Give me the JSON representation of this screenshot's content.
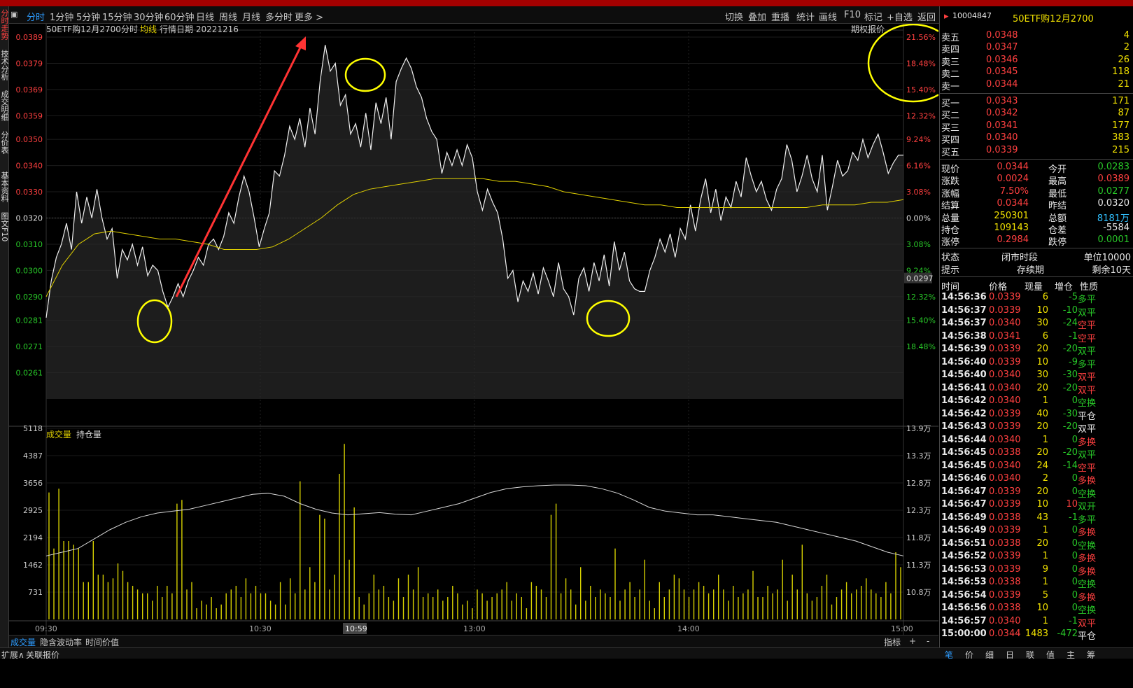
{
  "window": {
    "accent_color": "#a30000"
  },
  "left_rail": [
    "分时走势",
    "技术分析",
    "成交明细",
    "分价表",
    "基本资料",
    "图文F10"
  ],
  "tabs": [
    "分时",
    "1分钟",
    "5分钟",
    "15分钟",
    "30分钟",
    "60分钟",
    "日线",
    "周线",
    "月线",
    "多分时",
    "更多 >"
  ],
  "tools": [
    "切换",
    "叠加",
    "重播",
    "统计",
    "画线",
    "F10",
    "标记",
    "+自选",
    "返回"
  ],
  "chart_header": {
    "name": "50ETF购12月2700",
    "mode": "分时",
    "avg_label": "均线",
    "date_label": "行情日期 20221216",
    "right_label": "期权报价"
  },
  "chart_data": {
    "type": "line",
    "price_axis": {
      "ticks": [
        "0.0389",
        "0.0379",
        "0.0369",
        "0.0359",
        "0.0350",
        "0.0340",
        "0.0330",
        "0.0320",
        "0.0310",
        "0.0300",
        "0.0290",
        "0.0281",
        "0.0271",
        "0.0261"
      ],
      "pct_ticks": [
        "21.56%",
        "18.48%",
        "15.40%",
        "12.32%",
        "9.24%",
        "6.16%",
        "3.08%",
        "0.00%",
        "3.08%",
        "9.24%",
        "12.32%",
        "15.40%",
        "18.48%"
      ],
      "ylim": [
        0.0251,
        0.0389
      ],
      "prev_close": 0.032,
      "last_price_tag": "0.0297"
    },
    "price_series": [
      0.0282,
      0.0296,
      0.0305,
      0.031,
      0.0318,
      0.0308,
      0.033,
      0.0318,
      0.0328,
      0.032,
      0.0331,
      0.032,
      0.0312,
      0.0316,
      0.0297,
      0.0308,
      0.0304,
      0.031,
      0.0302,
      0.0309,
      0.0298,
      0.0302,
      0.03,
      0.0292,
      0.0286,
      0.029,
      0.0295,
      0.029,
      0.0296,
      0.03,
      0.0305,
      0.0302,
      0.031,
      0.0312,
      0.0308,
      0.0313,
      0.0322,
      0.0318,
      0.0328,
      0.0336,
      0.033,
      0.032,
      0.0309,
      0.0316,
      0.0322,
      0.0338,
      0.0336,
      0.0344,
      0.0355,
      0.035,
      0.0358,
      0.0347,
      0.0362,
      0.0352,
      0.0372,
      0.0386,
      0.0376,
      0.0379,
      0.0363,
      0.0367,
      0.0352,
      0.0356,
      0.0347,
      0.036,
      0.0346,
      0.0364,
      0.0356,
      0.0366,
      0.035,
      0.0372,
      0.0377,
      0.0381,
      0.0377,
      0.037,
      0.0366,
      0.0358,
      0.0353,
      0.035,
      0.0337,
      0.0345,
      0.034,
      0.0346,
      0.034,
      0.0348,
      0.0343,
      0.033,
      0.0323,
      0.0331,
      0.0326,
      0.0322,
      0.0312,
      0.0297,
      0.03,
      0.0288,
      0.0296,
      0.0292,
      0.0299,
      0.0291,
      0.0301,
      0.0296,
      0.029,
      0.0303,
      0.0293,
      0.029,
      0.0283,
      0.0297,
      0.0301,
      0.0292,
      0.0303,
      0.0296,
      0.0306,
      0.0294,
      0.0311,
      0.03,
      0.0307,
      0.0296,
      0.0293,
      0.0292,
      0.0292,
      0.03,
      0.0305,
      0.0312,
      0.0307,
      0.0314,
      0.0305,
      0.0316,
      0.0312,
      0.0325,
      0.0315,
      0.0327,
      0.0335,
      0.0322,
      0.0331,
      0.0319,
      0.0328,
      0.0324,
      0.0334,
      0.0328,
      0.0343,
      0.0336,
      0.033,
      0.0334,
      0.0327,
      0.0323,
      0.0331,
      0.0335,
      0.0348,
      0.0342,
      0.033,
      0.0336,
      0.0344,
      0.0335,
      0.033,
      0.0344,
      0.0323,
      0.0332,
      0.0342,
      0.0336,
      0.0338,
      0.0345,
      0.0342,
      0.035,
      0.0343,
      0.0348,
      0.0352,
      0.0345,
      0.0337,
      0.0341,
      0.0344,
      0.0344
    ],
    "avg_series": [
      0.029,
      0.0302,
      0.031,
      0.0314,
      0.0315,
      0.0314,
      0.0313,
      0.0312,
      0.0312,
      0.0311,
      0.031,
      0.0308,
      0.0308,
      0.0308,
      0.0309,
      0.0312,
      0.0316,
      0.032,
      0.0325,
      0.0329,
      0.0331,
      0.0332,
      0.0333,
      0.0334,
      0.0335,
      0.0335,
      0.0335,
      0.0335,
      0.0334,
      0.0334,
      0.0333,
      0.0332,
      0.033,
      0.0329,
      0.0328,
      0.0327,
      0.0326,
      0.0325,
      0.0325,
      0.0324,
      0.0324,
      0.0324,
      0.0324,
      0.0324,
      0.0324,
      0.0324,
      0.0324,
      0.0324,
      0.0325,
      0.0325,
      0.0325,
      0.0326,
      0.0326,
      0.0327
    ],
    "volume_axis": {
      "ticks": [
        "5118",
        "4387",
        "3656",
        "2925",
        "2194",
        "1462",
        "731"
      ],
      "oi_ticks": [
        "13.9万",
        "13.3万",
        "12.8万",
        "12.3万",
        "11.8万",
        "11.3万",
        "10.8万"
      ],
      "ylim": [
        0,
        5118
      ]
    },
    "volume_series": [
      3400,
      1900,
      3500,
      2100,
      2100,
      2000,
      1900,
      1000,
      1000,
      2100,
      1200,
      1200,
      1000,
      1100,
      1500,
      1300,
      1000,
      900,
      800,
      700,
      700,
      500,
      900,
      600,
      900,
      700,
      3100,
      3200,
      800,
      1000,
      300,
      500,
      400,
      600,
      300,
      400,
      700,
      800,
      900,
      600,
      1100,
      700,
      900,
      700,
      700,
      500,
      400,
      1000,
      400,
      1100,
      700,
      3700,
      800,
      1400,
      1000,
      2800,
      2700,
      800,
      1200,
      3900,
      4700,
      1600,
      3000,
      600,
      400,
      700,
      1200,
      800,
      900,
      600,
      500,
      1100,
      600,
      1200,
      800,
      1400,
      600,
      700,
      600,
      800,
      500,
      600,
      900,
      700,
      400,
      500,
      300,
      800,
      700,
      500,
      600,
      700,
      800,
      1000,
      500,
      700,
      600,
      300,
      1000,
      900,
      800,
      600,
      2800,
      3100,
      700,
      1100,
      800,
      400,
      1400,
      500,
      900,
      600,
      800,
      700,
      600,
      1900,
      500,
      800,
      1000,
      600,
      800,
      1600,
      500,
      300,
      1000,
      600,
      800,
      1200,
      1100,
      800,
      600,
      800,
      1000,
      900,
      700,
      800,
      1200,
      800,
      500,
      900,
      600,
      700,
      800,
      1300,
      600,
      600,
      900,
      700,
      800,
      1600,
      500,
      1200,
      800,
      2000,
      700,
      500,
      600,
      900,
      1200,
      400,
      600,
      800,
      1000,
      700,
      800,
      900,
      1100,
      800,
      700,
      600,
      1000,
      700,
      1800,
      1400
    ],
    "oi_series": [
      1700,
      1800,
      1900,
      2150,
      2400,
      2600,
      2750,
      2850,
      2900,
      2950,
      3050,
      3150,
      3250,
      3350,
      3380,
      3300,
      3100,
      2950,
      2850,
      2800,
      2830,
      2860,
      2820,
      2800,
      2900,
      3000,
      3100,
      3250,
      3400,
      3500,
      3550,
      3580,
      3600,
      3600,
      3580,
      3500,
      3380,
      3200,
      3000,
      2900,
      2850,
      2800,
      2800,
      2750,
      2700,
      2650,
      2600,
      2500,
      2400,
      2300,
      2200,
      2100,
      1950,
      1800,
      1700
    ],
    "xticks": [
      "09:30",
      "10:30",
      "13:00",
      "14:00",
      "15:00"
    ],
    "cursor_time": "10:59",
    "volume_legend": [
      "成交量",
      "持仓量"
    ]
  },
  "order_book": {
    "sell": [
      {
        "label": "卖五",
        "price": "0.0348",
        "qty": "4"
      },
      {
        "label": "卖四",
        "price": "0.0347",
        "qty": "2"
      },
      {
        "label": "卖三",
        "price": "0.0346",
        "qty": "26"
      },
      {
        "label": "卖二",
        "price": "0.0345",
        "qty": "118"
      },
      {
        "label": "卖一",
        "price": "0.0344",
        "qty": "21"
      }
    ],
    "buy": [
      {
        "label": "买一",
        "price": "0.0343",
        "qty": "171"
      },
      {
        "label": "买二",
        "price": "0.0342",
        "qty": "87"
      },
      {
        "label": "买三",
        "price": "0.0341",
        "qty": "177"
      },
      {
        "label": "买四",
        "price": "0.0340",
        "qty": "383"
      },
      {
        "label": "买五",
        "price": "0.0339",
        "qty": "215"
      }
    ]
  },
  "instrument": {
    "code": "10004847",
    "name": "50ETF购12月2700"
  },
  "quote": [
    {
      "l1": "现价",
      "v1": "0.0344",
      "c1": "red",
      "l2": "今开",
      "v2": "0.0283",
      "c2": "grn"
    },
    {
      "l1": "涨跌",
      "v1": "0.0024",
      "c1": "red",
      "l2": "最高",
      "v2": "0.0389",
      "c2": "red"
    },
    {
      "l1": "涨幅",
      "v1": "7.50%",
      "c1": "red",
      "l2": "最低",
      "v2": "0.0277",
      "c2": "grn"
    },
    {
      "l1": "结算",
      "v1": "0.0344",
      "c1": "red",
      "l2": "昨结",
      "v2": "0.0320",
      "c2": "wht"
    },
    {
      "l1": "总量",
      "v1": "250301",
      "c1": "yel",
      "l2": "总额",
      "v2": "8181万",
      "c2": "cyn"
    },
    {
      "l1": "持仓",
      "v1": "109143",
      "c1": "yel",
      "l2": "仓差",
      "v2": "-5584",
      "c2": "wht"
    },
    {
      "l1": "涨停",
      "v1": "0.2984",
      "c1": "red",
      "l2": "跌停",
      "v2": "0.0001",
      "c2": "grn"
    }
  ],
  "status": {
    "l1": "状态",
    "v1": "闭市时段",
    "u1": "单位10000",
    "l2": "提示",
    "v2": "存续期",
    "u2": "剩余10天"
  },
  "ticks_header": [
    "时间",
    "价格",
    "现量",
    "增仓",
    "性质"
  ],
  "ticks": [
    [
      "14:56:36",
      "0.0339",
      "6",
      "-5",
      "多平",
      "red",
      "grn"
    ],
    [
      "14:56:37",
      "0.0339",
      "10",
      "-10",
      "双平",
      "red",
      "grn"
    ],
    [
      "14:56:37",
      "0.0340",
      "30",
      "-24",
      "空平",
      "red",
      "red"
    ],
    [
      "14:56:38",
      "0.0341",
      "6",
      "-1",
      "空平",
      "red",
      "red"
    ],
    [
      "14:56:39",
      "0.0339",
      "20",
      "-20",
      "双平",
      "red",
      "grn"
    ],
    [
      "14:56:40",
      "0.0339",
      "10",
      "-9",
      "多平",
      "red",
      "grn"
    ],
    [
      "14:56:40",
      "0.0340",
      "30",
      "-30",
      "双平",
      "red",
      "red"
    ],
    [
      "14:56:41",
      "0.0340",
      "20",
      "-20",
      "双平",
      "red",
      "red"
    ],
    [
      "14:56:42",
      "0.0340",
      "1",
      "0",
      "空换",
      "red",
      "grn"
    ],
    [
      "14:56:42",
      "0.0339",
      "40",
      "-30",
      "平仓",
      "red",
      "wht"
    ],
    [
      "14:56:43",
      "0.0339",
      "20",
      "-20",
      "双平",
      "red",
      "wht"
    ],
    [
      "14:56:44",
      "0.0340",
      "1",
      "0",
      "多换",
      "red",
      "red"
    ],
    [
      "14:56:45",
      "0.0338",
      "20",
      "-20",
      "双平",
      "red",
      "grn"
    ],
    [
      "14:56:45",
      "0.0340",
      "24",
      "-14",
      "空平",
      "red",
      "red"
    ],
    [
      "14:56:46",
      "0.0340",
      "2",
      "0",
      "多换",
      "red",
      "red"
    ],
    [
      "14:56:47",
      "0.0339",
      "20",
      "0",
      "空换",
      "red",
      "grn"
    ],
    [
      "14:56:47",
      "0.0339",
      "10",
      "10",
      "双开",
      "red",
      "grn"
    ],
    [
      "14:56:49",
      "0.0338",
      "43",
      "-1",
      "多平",
      "red",
      "grn"
    ],
    [
      "14:56:49",
      "0.0339",
      "1",
      "0",
      "多换",
      "red",
      "red"
    ],
    [
      "14:56:51",
      "0.0338",
      "20",
      "0",
      "空换",
      "red",
      "grn"
    ],
    [
      "14:56:52",
      "0.0339",
      "1",
      "0",
      "多换",
      "red",
      "red"
    ],
    [
      "14:56:53",
      "0.0339",
      "9",
      "0",
      "多换",
      "red",
      "red"
    ],
    [
      "14:56:53",
      "0.0338",
      "1",
      "0",
      "空换",
      "red",
      "grn"
    ],
    [
      "14:56:54",
      "0.0339",
      "5",
      "0",
      "多换",
      "red",
      "red"
    ],
    [
      "14:56:56",
      "0.0338",
      "10",
      "0",
      "空换",
      "red",
      "grn"
    ],
    [
      "14:56:57",
      "0.0340",
      "1",
      "-1",
      "双平",
      "red",
      "red"
    ],
    [
      "15:00:00",
      "0.0344",
      "1483",
      "-472",
      "平仓",
      "red",
      "wht"
    ]
  ],
  "bottom_tabs": [
    "成交量",
    "隐含波动率",
    "时间价值"
  ],
  "bottom_right": [
    "指标",
    "+",
    "-"
  ],
  "status_line": [
    "扩展∧",
    "关联报价"
  ],
  "rp_footer": [
    "笔",
    "价",
    "细",
    "日",
    "联",
    "值",
    "主",
    "筹"
  ],
  "annotation_color": "#ffff00",
  "arrow_color": "#ff3333"
}
